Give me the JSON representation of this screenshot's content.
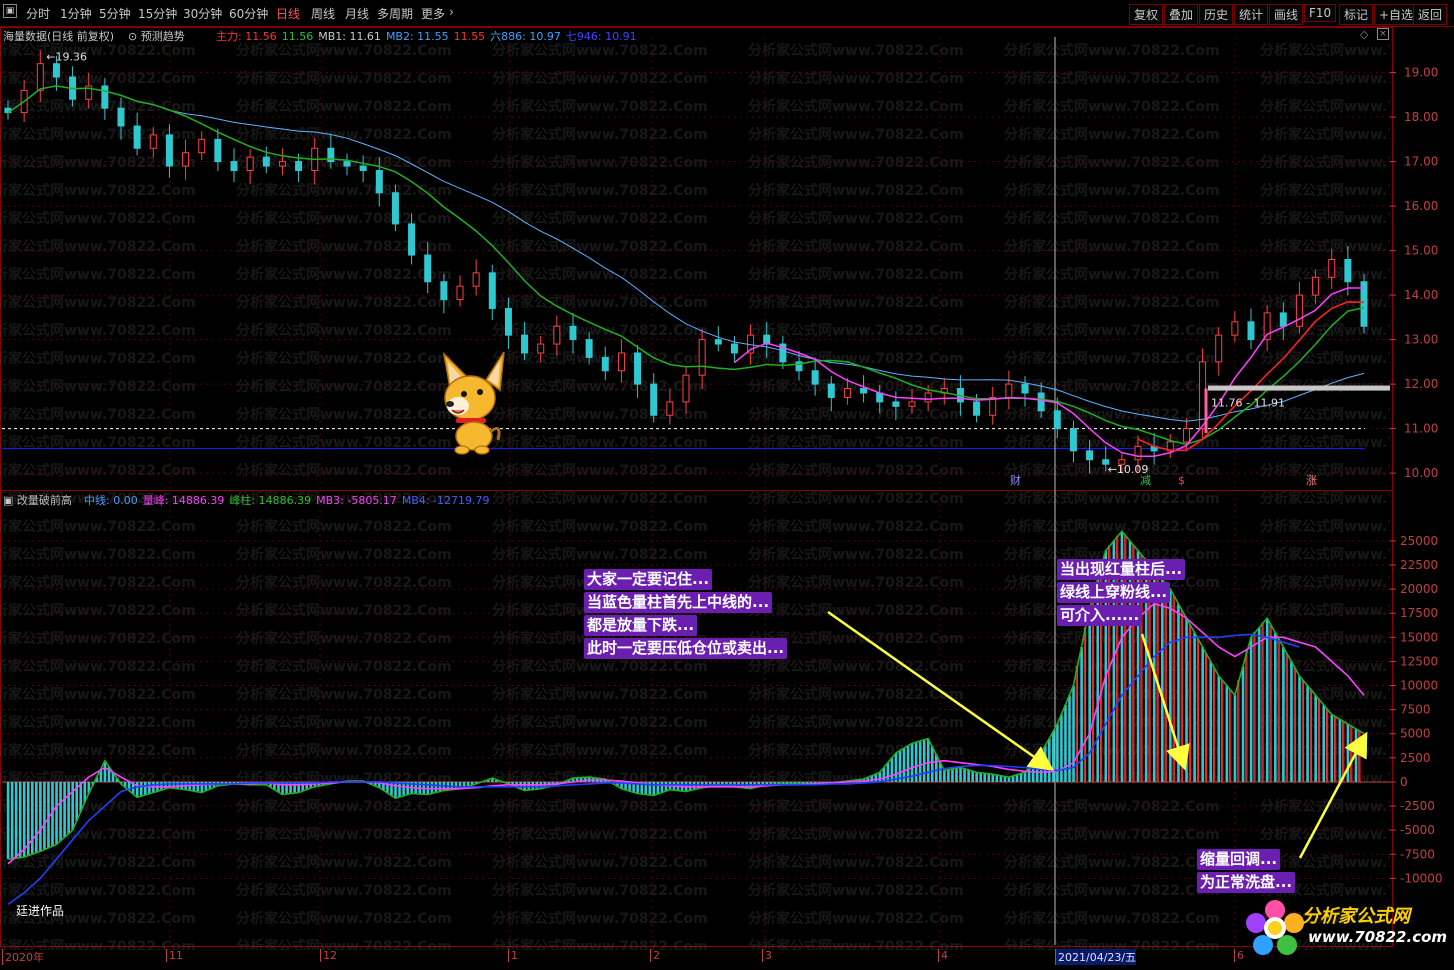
{
  "toolbar": {
    "left": [
      "分时",
      "1分钟",
      "5分钟",
      "15分钟",
      "30分钟",
      "60分钟",
      "日线",
      "周线",
      "月线",
      "多周期",
      "更多"
    ],
    "active": "日线",
    "right": [
      "复权",
      "叠加",
      "历史",
      "统计",
      "画线",
      "F10",
      "标记",
      "+自选",
      "返回"
    ]
  },
  "main_panel": {
    "title": "海量数据(日线 前复权)",
    "predict": "预测趋势",
    "indicators": [
      {
        "text": "主力: 11.56",
        "color": "#ff3030"
      },
      {
        "text": "11.56",
        "color": "#30c030"
      },
      {
        "text": "MB1: 11.61",
        "color": "#c8c8c8"
      },
      {
        "text": "MB2: 11.55",
        "color": "#40a0ff"
      },
      {
        "text": "11.55",
        "color": "#ff3030"
      },
      {
        "text": "六886: 10.97",
        "color": "#40a0ff"
      },
      {
        "text": "七946: 10.91",
        "color": "#4040ff"
      }
    ],
    "annotations": {
      "high": "19.36",
      "low": "10.09",
      "range_label": "11.76 - 11.91"
    },
    "markers": [
      "财",
      "减",
      "$",
      "涨"
    ]
  },
  "sub_panel": {
    "title": "改量破前高",
    "indicators": [
      {
        "text": "中线: 0.00",
        "color": "#40a0ff"
      },
      {
        "text": "量峰: 14886.39",
        "color": "#ff40ff"
      },
      {
        "text": "峰柱: 14886.39",
        "color": "#30c030"
      },
      {
        "text": "MB3: -5805.17",
        "color": "#ff40ff"
      },
      {
        "text": "MB4: -12719.79",
        "color": "#4060ff"
      }
    ],
    "author": "廷进作品"
  },
  "notes": [
    {
      "lines": [
        "大家一定要记住...",
        "当蓝色量柱首先上中线的...",
        "都是放量下跌...",
        "此时一定要压低仓位或卖出..."
      ]
    },
    {
      "lines": [
        "当出现红量柱后...",
        "绿线上穿粉线...",
        "可介入......"
      ]
    },
    {
      "lines": [
        "缩量回调...",
        "为正常洗盘..."
      ]
    }
  ],
  "watermark": "分析家公式网www.70822.Com",
  "logo": {
    "text": "分析家公式网",
    "url": "www.70822.com"
  },
  "chart_data": [
    {
      "type": "candlestick",
      "title": "海量数据(日线 前复权)",
      "ylim": [
        9.8,
        19.8
      ],
      "yticks": [
        10.0,
        11.0,
        12.0,
        13.0,
        14.0,
        15.0,
        16.0,
        17.0,
        18.0,
        19.0
      ],
      "close": [
        18.1,
        18.6,
        19.2,
        18.9,
        18.4,
        18.7,
        18.2,
        17.8,
        17.3,
        17.6,
        16.9,
        17.2,
        17.5,
        17.0,
        16.8,
        17.1,
        16.9,
        17.0,
        16.8,
        17.3,
        17.0,
        16.9,
        16.8,
        16.3,
        15.6,
        14.9,
        14.3,
        13.9,
        14.2,
        14.5,
        13.7,
        13.1,
        12.7,
        12.9,
        13.3,
        13.0,
        12.6,
        12.3,
        12.7,
        12.0,
        11.3,
        11.6,
        12.2,
        13.0,
        12.9,
        12.7,
        13.1,
        12.9,
        12.5,
        12.3,
        12.0,
        11.7,
        11.9,
        11.8,
        11.6,
        11.5,
        11.6,
        11.8,
        11.9,
        11.6,
        11.3,
        11.7,
        12.0,
        11.8,
        11.4,
        11.0,
        10.5,
        10.3,
        10.2,
        10.3,
        10.6,
        10.5,
        10.7,
        11.0,
        12.5,
        13.1,
        13.4,
        13.0,
        13.6,
        13.3,
        14.0,
        14.4,
        14.8,
        14.3,
        13.3
      ],
      "x_labels": [
        "2020年",
        "11",
        "12",
        "1",
        "2",
        "3",
        "4",
        "2021/04/23/五",
        "6"
      ],
      "hlines": [
        10.55,
        11.0
      ],
      "annotations": {
        "high": 19.36,
        "low": 10.09
      }
    },
    {
      "type": "bar",
      "title": "改量破前高",
      "ylim": [
        -11000,
        28000
      ],
      "yticks": [
        -10000,
        -7500,
        -5000,
        -2500,
        0,
        2500,
        5000,
        7500,
        10000,
        12500,
        15000,
        17500,
        20000,
        22500,
        25000
      ],
      "values": [
        -8000,
        -7800,
        -7200,
        -6500,
        -5000,
        -1200,
        2200,
        -200,
        -1600,
        -1100,
        -600,
        -800,
        -1100,
        -400,
        -200,
        -300,
        -300,
        -1300,
        -1100,
        -500,
        -200,
        100,
        100,
        -600,
        -1700,
        -1200,
        -1300,
        -900,
        -700,
        -200,
        400,
        -200,
        -900,
        -700,
        -300,
        400,
        500,
        300,
        -700,
        -1200,
        -1400,
        -800,
        -1000,
        -600,
        -400,
        -500,
        -700,
        -300,
        -200,
        -200,
        -200,
        -100,
        100,
        300,
        1000,
        3000,
        4000,
        4500,
        1200,
        1500,
        1000,
        800,
        500,
        1000,
        3000,
        6000,
        10000,
        18000,
        24000,
        26000,
        24000,
        22000,
        20000,
        17000,
        14000,
        11000,
        9000,
        15000,
        17000,
        14000,
        11000,
        9000,
        7000,
        6000,
        5000
      ],
      "series": [
        {
          "name": "MB3",
          "color": "#ff40ff",
          "values": [
            -8500,
            -7000,
            -5000,
            -2500,
            -1000,
            500,
            1500,
            500,
            -400,
            -500,
            -500,
            -400,
            -300,
            -200,
            -200,
            -200,
            -100,
            -300,
            -300,
            -200,
            -100,
            0,
            0,
            -100,
            -400,
            -600,
            -700,
            -700,
            -700,
            -600,
            -400,
            -300,
            -300,
            -300,
            -200,
            0,
            200,
            200,
            100,
            -100,
            -300,
            -400,
            -500,
            -500,
            -500,
            -500,
            -500,
            -400,
            -300,
            -300,
            -200,
            -100,
            0,
            100,
            300,
            800,
            1500,
            2000,
            2200,
            2000,
            1800,
            1600,
            1300,
            1100,
            1000,
            1100,
            2000,
            5000,
            11000,
            15000,
            17000,
            18500,
            18000,
            17000,
            15500,
            14000,
            13000,
            14000,
            15000,
            15000,
            14500,
            14000,
            12500,
            11000,
            9000
          ]
        },
        {
          "name": "MB4",
          "color": "#2040ff",
          "values": [
            -12700,
            -11500,
            -10000,
            -8000,
            -6000,
            -4000,
            -2500,
            -1000,
            -500,
            -300,
            -200,
            -200,
            -200,
            -200,
            -200,
            -100,
            -100,
            -100,
            -100,
            -100,
            0,
            0,
            0,
            0,
            -100,
            -200,
            -300,
            -400,
            -500,
            -500,
            -500,
            -500,
            -500,
            -500,
            -400,
            -300,
            -200,
            -100,
            -100,
            -200,
            -300,
            -300,
            -300,
            -300,
            -300,
            -300,
            -300,
            -300,
            -300,
            -300,
            -300,
            -200,
            -200,
            -100,
            0,
            300,
            600,
            1000,
            1400,
            1600,
            1700,
            1700,
            1600,
            1500,
            1300,
            1200,
            1500,
            3000,
            6000,
            9000,
            11000,
            13000,
            14500,
            15000,
            15000,
            15000,
            15200,
            15300,
            15000,
            14500,
            14000
          ]
        }
      ],
      "x_labels": [
        "2020年",
        "11",
        "12",
        "1",
        "2",
        "3",
        "4",
        "2021/04/23/五",
        "6"
      ]
    }
  ]
}
